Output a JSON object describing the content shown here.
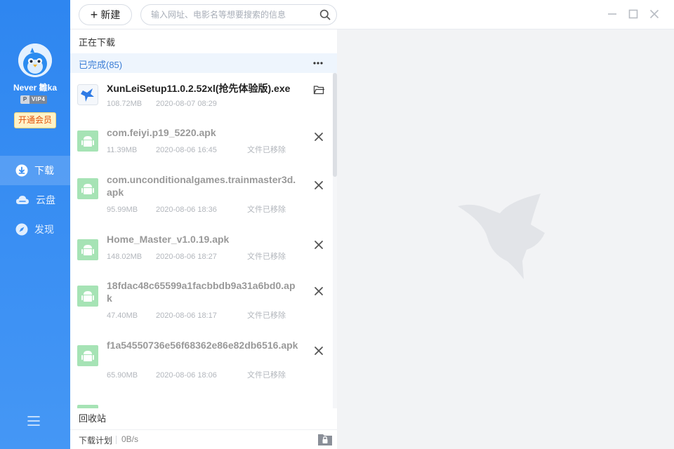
{
  "user": {
    "name": "Never 雛ka",
    "vip_p": "P",
    "vip_level": "VIP4",
    "member_button": "开通会员"
  },
  "sidebar": {
    "items": [
      {
        "label": "下载",
        "icon": "download-icon",
        "active": true
      },
      {
        "label": "云盘",
        "icon": "cloud-icon",
        "active": false
      },
      {
        "label": "发现",
        "icon": "compass-icon",
        "active": false
      }
    ],
    "menu_icon": "hamburger-icon"
  },
  "topbar": {
    "new_label": "新建",
    "search_placeholder": "输入网址、电影名等想要搜索的信息"
  },
  "sections": {
    "downloading": "正在下载",
    "completed": "已完成(85)",
    "recycle": "回收站"
  },
  "downloads": [
    {
      "name": "XunLeiSetup11.0.2.52xl(抢先体验版).exe",
      "size": "108.72MB",
      "time": "2020-08-07 08:29",
      "status": "",
      "icon": "xunlei-app-icon",
      "action": "open-folder-icon"
    },
    {
      "name": "com.feiyi.p19_5220.apk",
      "size": "11.39MB",
      "time": "2020-08-06 16:45",
      "status": "文件已移除",
      "icon": "android-icon",
      "action": "remove-icon"
    },
    {
      "name": "com.unconditionalgames.trainmaster3d.apk",
      "size": "95.99MB",
      "time": "2020-08-06 18:36",
      "status": "文件已移除",
      "icon": "android-icon",
      "action": "remove-icon"
    },
    {
      "name": "Home_Master_v1.0.19.apk",
      "size": "148.02MB",
      "time": "2020-08-06 18:27",
      "status": "文件已移除",
      "icon": "android-icon",
      "action": "remove-icon"
    },
    {
      "name": "18fdac48c65599a1facbbdb9a31a6bd0.apk",
      "size": "47.40MB",
      "time": "2020-08-06 18:17",
      "status": "文件已移除",
      "icon": "android-icon",
      "action": "remove-icon"
    },
    {
      "name": "f1a54550736e56f68362e86e82db6516.apk",
      "size": "65.90MB",
      "time": "2020-08-06 18:06",
      "status": "文件已移除",
      "icon": "android-icon",
      "action": "remove-icon"
    }
  ],
  "status": {
    "plan": "下载计划",
    "speed": "0B/s"
  },
  "colors": {
    "sidebar": "#2e86f0",
    "accent": "#3c7ed6",
    "android_icon": "#a6e3b5",
    "member_bg": "#fff3c8",
    "member_text": "#e2520c"
  }
}
